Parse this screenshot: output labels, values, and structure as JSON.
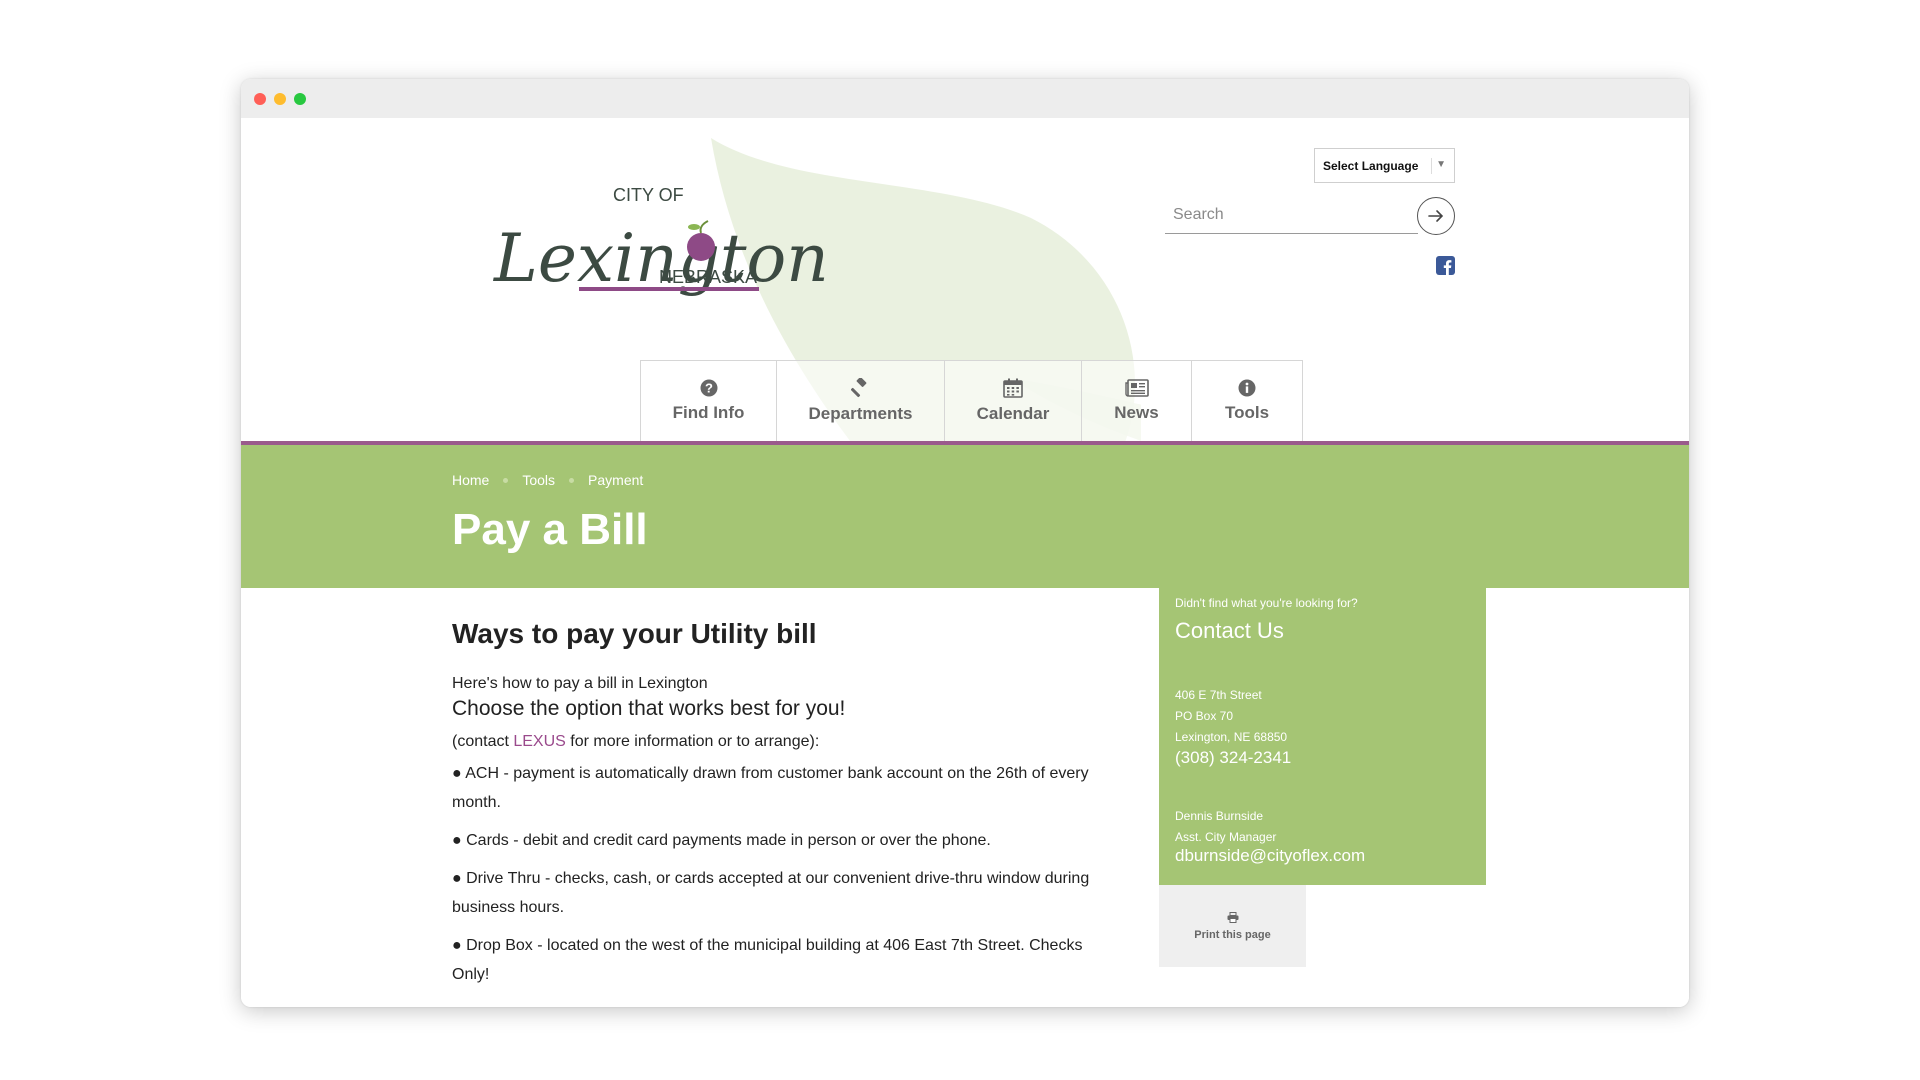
{
  "header": {
    "logo": {
      "line1": "CITY OF",
      "script": "Lexington",
      "line3": "NEBRASKA"
    },
    "language_select": {
      "label": "Select Language"
    },
    "search": {
      "placeholder": "Search"
    },
    "colors": {
      "accent_green": "#a5c574",
      "accent_purple": "#9a5a8c",
      "logo_text": "#3c4a42"
    }
  },
  "nav": [
    {
      "label": "Find Info",
      "icon": "question-circle-icon"
    },
    {
      "label": "Departments",
      "icon": "gavel-icon"
    },
    {
      "label": "Calendar",
      "icon": "calendar-icon"
    },
    {
      "label": "News",
      "icon": "newspaper-icon"
    },
    {
      "label": "Tools",
      "icon": "info-circle-icon"
    }
  ],
  "breadcrumb": [
    "Home",
    "Tools",
    "Payment"
  ],
  "page_title": "Pay a Bill",
  "main": {
    "heading": "Ways to pay your Utility bill",
    "intro": "Here's how to pay a bill in Lexington",
    "lead": "Choose the option that works best for you!",
    "contact_prefix": "(contact ",
    "contact_link": "LEXUS",
    "contact_suffix": " for more information or to arrange):",
    "bullets": [
      "● ACH - payment is automatically drawn from customer bank account on the 26th of every month.",
      "● Cards - debit and credit card payments made in person or over the phone.",
      "● Drive Thru - checks, cash, or cards accepted at our convenient drive-thru window during business hours.",
      "● Drop Box - located on the west of the municipal building at 406 East 7th Street. Checks Only!"
    ]
  },
  "sidebar": {
    "question": "Didn't find what you're looking for?",
    "title": "Contact Us",
    "address": [
      "406 E 7th Street",
      "PO Box 70",
      "Lexington, NE 68850"
    ],
    "phone": "(308) 324-2341",
    "person_name": "Dennis Burnside",
    "person_title": "Asst. City Manager",
    "email": "dburnside@cityoflex.com"
  },
  "print": {
    "label": "Print this page"
  }
}
